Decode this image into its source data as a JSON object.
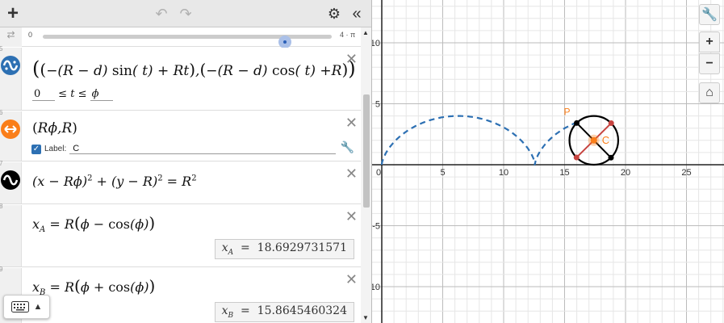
{
  "topbar": {
    "add": "+",
    "undo": "↶",
    "redo": "↷",
    "settings": "⚙",
    "collapse": "«"
  },
  "slider": {
    "icon": "⇄",
    "min": "0",
    "max": "4 · π"
  },
  "expressions": [
    {
      "number": "5",
      "icon": "parametric-curve-icon",
      "color": "#2d70b3",
      "latex": "((−(R − d) sin(t) + Rt), (−(R − d) cos(t) + R))",
      "range": {
        "low": "0",
        "op1": "≤",
        "var": "t",
        "op2": "≤",
        "high": "ϕ"
      }
    },
    {
      "number": "6",
      "icon": "point-icon",
      "color": "#fa7e19",
      "latex": "(Rϕ, R)",
      "label_checkbox": "Label:",
      "label_value": "C"
    },
    {
      "number": "7",
      "icon": "implicit-curve-icon",
      "color": "#000000",
      "latex": "(x − Rϕ)² + (y − R)² = R²"
    },
    {
      "number": "8",
      "latex": "x_A = R(ϕ − cos(ϕ))",
      "result_var": "x",
      "result_sub": "A",
      "result_value": "18.6929731571"
    },
    {
      "number": "9",
      "latex": "x_B = R(ϕ + cos(ϕ))",
      "result_var": "x",
      "result_sub": "B",
      "result_value": "15.8645460324"
    }
  ],
  "keyboard": {
    "icon": "keyboard-icon",
    "caret": "▲"
  },
  "graph": {
    "x_ticks": [
      "0",
      "5",
      "10",
      "15",
      "20",
      "25"
    ],
    "y_ticks": [
      "10",
      "5",
      "-5",
      "-10"
    ],
    "point_labels": {
      "P": "P",
      "C": "C"
    },
    "colors": {
      "curve": "#2d70b3",
      "point": "#fa7e19",
      "red": "#c74440",
      "black": "#000000"
    }
  },
  "side_buttons": {
    "wrench": "🔧",
    "zoom_in": "+",
    "zoom_out": "−",
    "home": "⌂"
  }
}
